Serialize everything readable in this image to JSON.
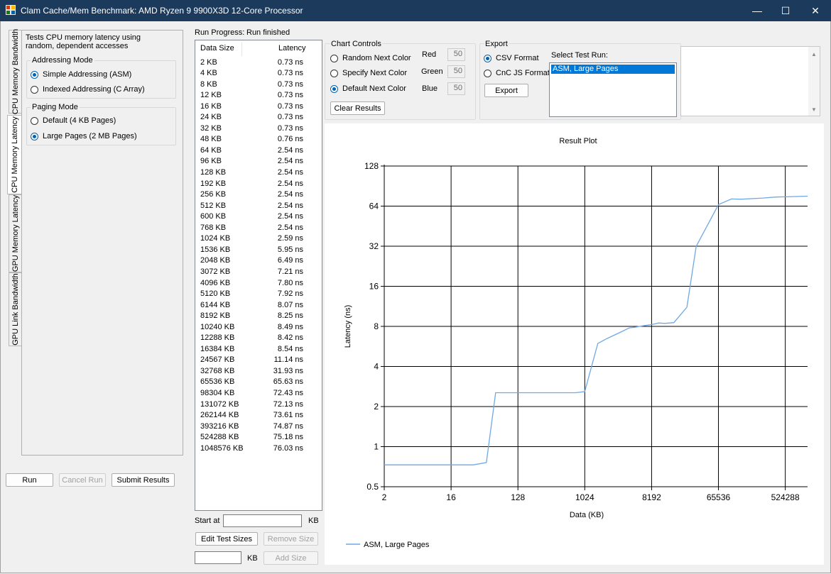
{
  "window": {
    "title": "Clam Cache/Mem Benchmark: AMD Ryzen 9 9900X3D 12-Core Processor",
    "minimize": "—",
    "maximize": "☐",
    "close": "✕"
  },
  "tabs": [
    {
      "label": "CPU Memory Bandwidth",
      "selected": false
    },
    {
      "label": "CPU Memory Latency",
      "selected": true
    },
    {
      "label": "GPU Memory Latency",
      "selected": false
    },
    {
      "label": "GPU Link Bandwidth",
      "selected": false
    }
  ],
  "panel": {
    "description": "Tests CPU memory latency using random, dependent accesses",
    "addressing": {
      "title": "Addressing Mode",
      "options": [
        "Simple Addressing (ASM)",
        "Indexed Addressing (C Array)"
      ],
      "selected": 0
    },
    "paging": {
      "title": "Paging Mode",
      "options": [
        "Default (4 KB Pages)",
        "Large Pages (2 MB Pages)"
      ],
      "selected": 1
    }
  },
  "actions": {
    "run": "Run",
    "cancel": "Cancel Run",
    "submit": "Submit Results"
  },
  "progress": {
    "label": "Run Progress:",
    "status": "Run finished"
  },
  "results": {
    "col_size": "Data Size",
    "col_latency": "Latency",
    "rows": [
      [
        "2 KB",
        "0.73 ns"
      ],
      [
        "4 KB",
        "0.73 ns"
      ],
      [
        "8 KB",
        "0.73 ns"
      ],
      [
        "12 KB",
        "0.73 ns"
      ],
      [
        "16 KB",
        "0.73 ns"
      ],
      [
        "24 KB",
        "0.73 ns"
      ],
      [
        "32 KB",
        "0.73 ns"
      ],
      [
        "48 KB",
        "0.76 ns"
      ],
      [
        "64 KB",
        "2.54 ns"
      ],
      [
        "96 KB",
        "2.54 ns"
      ],
      [
        "128 KB",
        "2.54 ns"
      ],
      [
        "192 KB",
        "2.54 ns"
      ],
      [
        "256 KB",
        "2.54 ns"
      ],
      [
        "512 KB",
        "2.54 ns"
      ],
      [
        "600 KB",
        "2.54 ns"
      ],
      [
        "768 KB",
        "2.54 ns"
      ],
      [
        "1024 KB",
        "2.59 ns"
      ],
      [
        "1536 KB",
        "5.95 ns"
      ],
      [
        "2048 KB",
        "6.49 ns"
      ],
      [
        "3072 KB",
        "7.21 ns"
      ],
      [
        "4096 KB",
        "7.80 ns"
      ],
      [
        "5120 KB",
        "7.92 ns"
      ],
      [
        "6144 KB",
        "8.07 ns"
      ],
      [
        "8192 KB",
        "8.25 ns"
      ],
      [
        "10240 KB",
        "8.49 ns"
      ],
      [
        "12288 KB",
        "8.42 ns"
      ],
      [
        "16384 KB",
        "8.54 ns"
      ],
      [
        "24567 KB",
        "11.14 ns"
      ],
      [
        "32768 KB",
        "31.93 ns"
      ],
      [
        "65536 KB",
        "65.63 ns"
      ],
      [
        "98304 KB",
        "72.43 ns"
      ],
      [
        "131072 KB",
        "72.13 ns"
      ],
      [
        "262144 KB",
        "73.61 ns"
      ],
      [
        "393216 KB",
        "74.87 ns"
      ],
      [
        "524288 KB",
        "75.18 ns"
      ],
      [
        "1048576 KB",
        "76.03 ns"
      ]
    ]
  },
  "sizes": {
    "start_label": "Start at",
    "start_value": "",
    "unit": "KB",
    "edit": "Edit Test Sizes",
    "remove": "Remove Size",
    "add_value": "",
    "add": "Add Size"
  },
  "chart_controls": {
    "title": "Chart Controls",
    "options": [
      "Random Next Color",
      "Specify Next Color",
      "Default Next Color"
    ],
    "selected": 2,
    "red_label": "Red",
    "red": "50",
    "green_label": "Green",
    "green": "50",
    "blue_label": "Blue",
    "blue": "50",
    "clear": "Clear Results"
  },
  "export": {
    "title": "Export",
    "options": [
      "CSV Format",
      "CnC JS Format"
    ],
    "selected": 0,
    "button": "Export",
    "select_label": "Select Test Run:",
    "runs": [
      "ASM, Large Pages"
    ]
  },
  "colors": {
    "titlebar": "#1c3a5c",
    "accent": "#0063b1",
    "series": "#6fa8e6",
    "selection": "#0078d7"
  },
  "chart_data": {
    "type": "line",
    "title": "Result Plot",
    "xlabel": "Data (KB)",
    "ylabel": "Latency (ns)",
    "x_scale": "log2",
    "y_scale": "log2",
    "xlim": [
      2,
      1048576
    ],
    "ylim": [
      0.5,
      128
    ],
    "xticks": [
      2,
      16,
      128,
      1024,
      8192,
      65536,
      524288
    ],
    "yticks": [
      0.5,
      1,
      2,
      4,
      8,
      16,
      32,
      64,
      128
    ],
    "grid": true,
    "legend": "bottom-left",
    "series": [
      {
        "name": "ASM, Large Pages",
        "x": [
          2,
          4,
          8,
          12,
          16,
          24,
          32,
          48,
          64,
          96,
          128,
          192,
          256,
          512,
          600,
          768,
          1024,
          1536,
          2048,
          3072,
          4096,
          5120,
          6144,
          8192,
          10240,
          12288,
          16384,
          24567,
          32768,
          65536,
          98304,
          131072,
          262144,
          393216,
          524288,
          1048576
        ],
        "y": [
          0.73,
          0.73,
          0.73,
          0.73,
          0.73,
          0.73,
          0.73,
          0.76,
          2.54,
          2.54,
          2.54,
          2.54,
          2.54,
          2.54,
          2.54,
          2.54,
          2.59,
          5.95,
          6.49,
          7.21,
          7.8,
          7.92,
          8.07,
          8.25,
          8.49,
          8.42,
          8.54,
          11.14,
          31.93,
          65.63,
          72.43,
          72.13,
          73.61,
          74.87,
          75.18,
          76.03
        ]
      }
    ]
  }
}
